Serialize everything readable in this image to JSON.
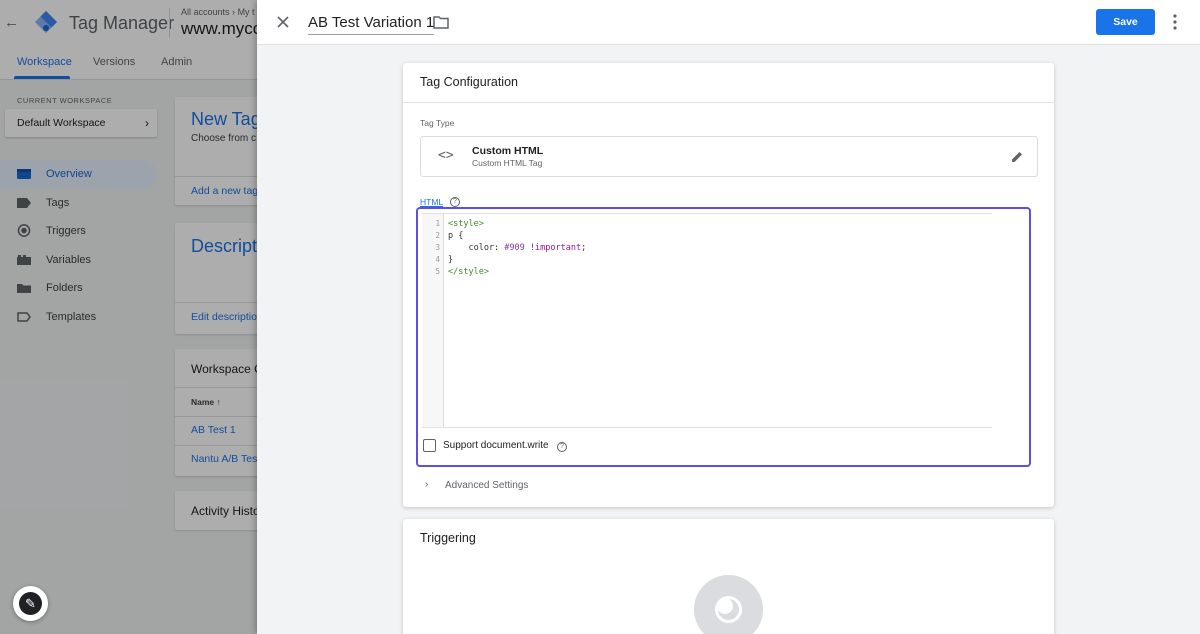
{
  "app": {
    "title": "Tag Manager",
    "crumb_accounts": "All accounts",
    "crumb_sep": "›",
    "crumb_account": "My t",
    "container": "www.myco"
  },
  "subnav": {
    "tabs": [
      "Workspace",
      "Versions",
      "Admin"
    ]
  },
  "workspace": {
    "label": "CURRENT WORKSPACE",
    "name": "Default Workspace"
  },
  "sidebar": {
    "items": [
      {
        "label": "Overview",
        "icon": "overview-icon"
      },
      {
        "label": "Tags",
        "icon": "tag-icon"
      },
      {
        "label": "Triggers",
        "icon": "trigger-icon"
      },
      {
        "label": "Variables",
        "icon": "variables-icon"
      },
      {
        "label": "Folders",
        "icon": "folder-icon"
      },
      {
        "label": "Templates",
        "icon": "template-icon"
      }
    ]
  },
  "cards": {
    "new_tag_title": "New Tag",
    "new_tag_sub": "Choose from c",
    "new_tag_link": "Add a new tag",
    "description_title": "Descript",
    "description_link": "Edit descriptio",
    "changes_title": "Workspace C",
    "col_name": "Name",
    "row1": "AB Test 1",
    "row2": "Nantu A/B Test",
    "activity_title": "Activity Histo"
  },
  "panel": {
    "tag_name": "AB Test Variation 1",
    "save_label": "Save",
    "config_title": "Tag Configuration",
    "tag_type_label": "Tag Type",
    "tag_type_name": "Custom HTML",
    "tag_type_desc": "Custom HTML Tag",
    "html_label": "HTML",
    "code_lines": [
      {
        "n": "1",
        "text": "<style>"
      },
      {
        "n": "2",
        "text": "p {"
      },
      {
        "n": "3",
        "text": "    color: #909 !important;"
      },
      {
        "n": "4",
        "text": "}"
      },
      {
        "n": "5",
        "text": "</style>"
      }
    ],
    "support_docwrite_label": "Support document.write",
    "advanced_settings_label": "Advanced Settings",
    "triggering_title": "Triggering"
  },
  "colors": {
    "accent": "#1a73e8",
    "editor_focus": "#5b4fe8",
    "code_tag": "#3e8e2e",
    "code_number": "#7b3fa0"
  }
}
